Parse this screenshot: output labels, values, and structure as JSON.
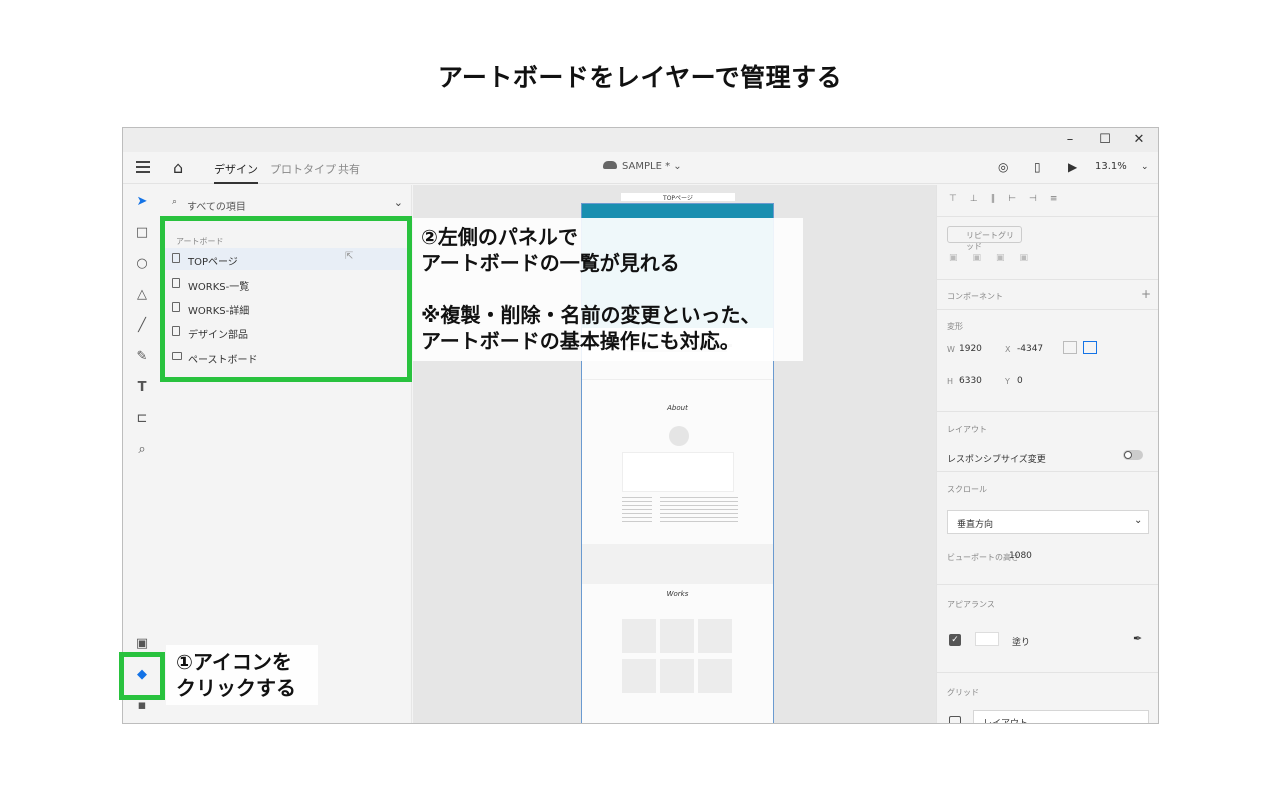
{
  "page": {
    "title": "アートボードをレイヤーで管理する"
  },
  "window": {
    "controls": [
      "–",
      "☐",
      "✕"
    ]
  },
  "appbar": {
    "tabs": [
      {
        "label": "デザイン",
        "active": true
      },
      {
        "label": "プロトタイプ",
        "active": false
      },
      {
        "label": "共有",
        "active": false
      }
    ],
    "doc_title": "SAMPLE * ⌄",
    "zoom": "13.1%"
  },
  "toolbar": {
    "icons": [
      "select-arrow-icon",
      "rectangle-icon",
      "ellipse-icon",
      "triangle-icon",
      "line-icon",
      "pen-icon",
      "text-icon",
      "artboard-icon",
      "zoom-icon",
      "assets-icon",
      "layers-icon",
      "plugins-icon"
    ]
  },
  "layers": {
    "search_placeholder": "すべての項目",
    "group_label": "アートボード",
    "items": [
      {
        "label": "TOPページ",
        "icon": "artboard-icon",
        "selected": true
      },
      {
        "label": "WORKS-一覧",
        "icon": "artboard-icon",
        "selected": false
      },
      {
        "label": "WORKS-詳細",
        "icon": "artboard-icon",
        "selected": false
      },
      {
        "label": "デザイン部品",
        "icon": "artboard-icon",
        "selected": false
      },
      {
        "label": "ペーストボード",
        "icon": "pasteboard-icon",
        "selected": false
      }
    ]
  },
  "canvas": {
    "artboard_label": "TOPページ",
    "about_heading": "About",
    "works_heading": "Works"
  },
  "props": {
    "repeat_grid": "リピートグリッド",
    "component": "コンポーネント",
    "transform": "変形",
    "w_label": "W",
    "w": "1920",
    "x_label": "X",
    "x": "-4347",
    "h_label": "H",
    "h": "6330",
    "y_label": "Y",
    "y": "0",
    "layout": "レイアウト",
    "responsive": "レスポンシブサイズ変更",
    "scroll": "スクロール",
    "scroll_value": "垂直方向",
    "viewport_label": "ビューポートの高さ",
    "viewport": "1080",
    "appearance": "アピアランス",
    "fill": "塗り",
    "grid": "グリッド",
    "grid_value": "レイアウト"
  },
  "annotations": {
    "panel_line1": "②左側のパネルで",
    "panel_line2": "アートボードの一覧が見れる",
    "note_line1": "※複製・削除・名前の変更といった、",
    "note_line2": "アートボードの基本操作にも対応。",
    "icon_line1": "①アイコンを",
    "icon_line2": "クリックする"
  },
  "colors": {
    "highlight": "#29c23e",
    "accent": "#1473e6",
    "artboard_header": "#1a8fb0"
  }
}
